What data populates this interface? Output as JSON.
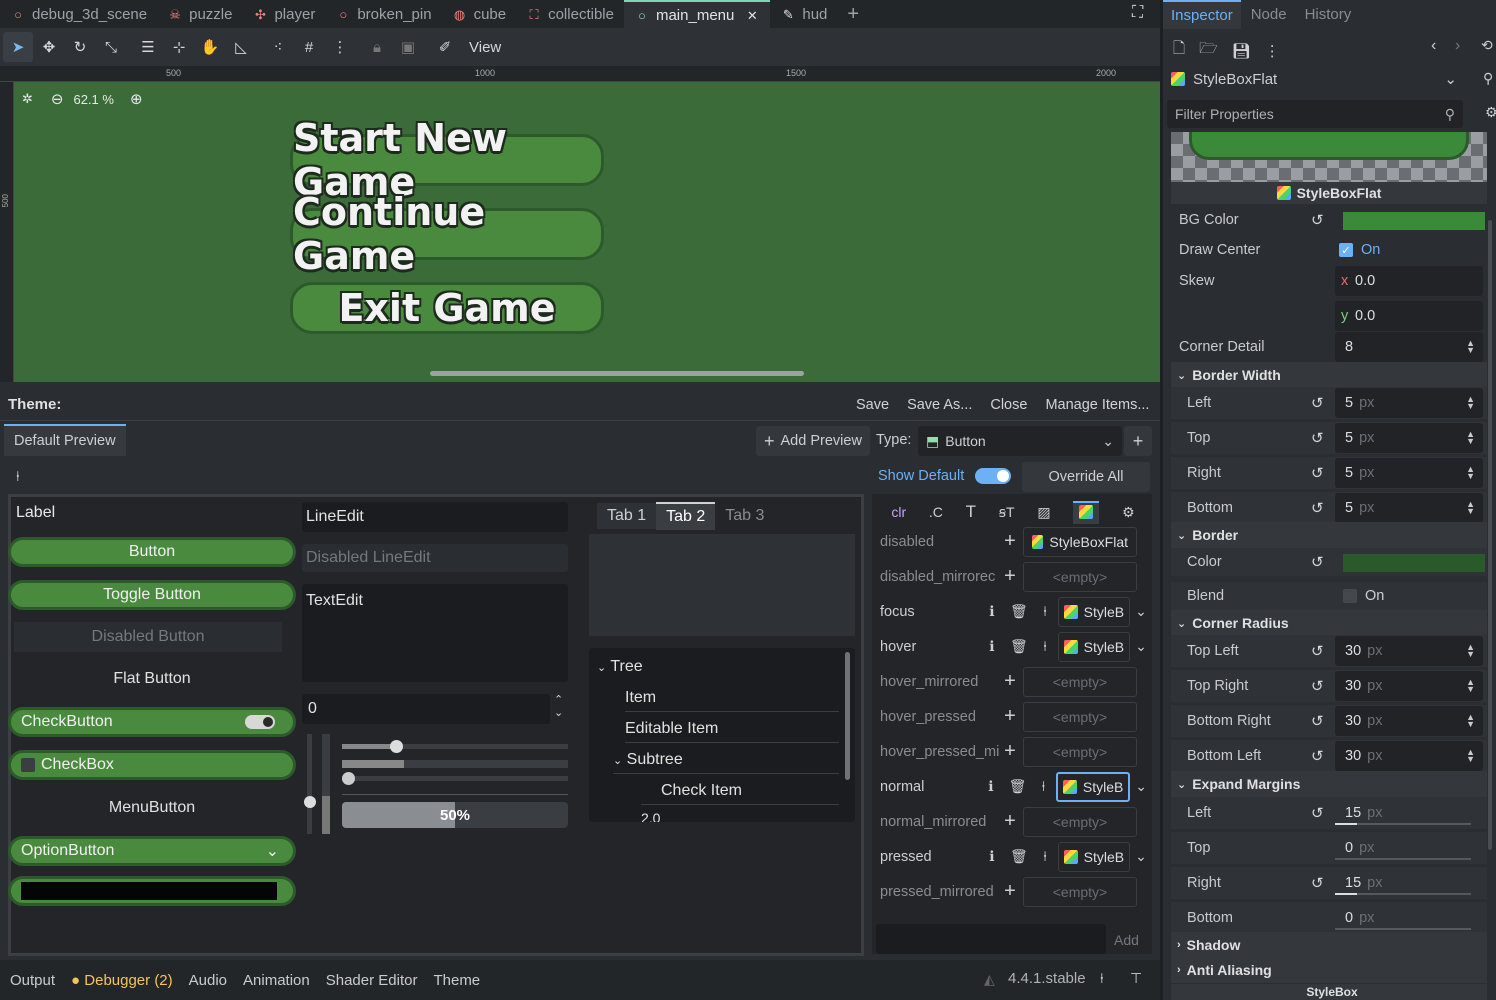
{
  "scene_tabs": [
    {
      "label": "debug_3d_scene",
      "icon": "circle-icon"
    },
    {
      "label": "puzzle",
      "icon": "skull-icon"
    },
    {
      "label": "player",
      "icon": "bone-icon"
    },
    {
      "label": "broken_pin",
      "icon": "circle-icon"
    },
    {
      "label": "cube",
      "icon": "sphere-icon"
    },
    {
      "label": "collectible",
      "icon": "bracket-icon"
    },
    {
      "label": "main_menu",
      "icon": "circle-icon",
      "active": true
    },
    {
      "label": "hud",
      "icon": "pencil-icon"
    }
  ],
  "toolbar": {
    "view_label": "View"
  },
  "ruler": {
    "top": [
      "500",
      "1000",
      "1500",
      "2000"
    ],
    "left": [
      "500"
    ]
  },
  "viewport": {
    "zoom": "62.1 %",
    "buttons": [
      "Start New Game",
      "Continue Game",
      "Exit Game"
    ]
  },
  "theme": {
    "title": "Theme:",
    "save": "Save",
    "save_as": "Save As...",
    "close": "Close",
    "manage": "Manage Items...",
    "preview_tab": "Default Preview",
    "add_preview": "Add Preview",
    "type_label": "Type:",
    "type_value": "Button",
    "show_default": "Show Default",
    "override_all": "Override All",
    "preview": {
      "label": "Label",
      "button": "Button",
      "toggle": "Toggle Button",
      "disabled": "Disabled Button",
      "flat": "Flat Button",
      "checkbutton": "CheckButton",
      "checkbox": "CheckBox",
      "menubutton": "MenuButton",
      "optionbutton": "OptionButton",
      "lineedit": "LineEdit",
      "disabled_lineedit": "Disabled LineEdit",
      "textedit": "TextEdit",
      "spin_value": "0",
      "progress": "50%",
      "tabs": [
        "Tab 1",
        "Tab 2",
        "Tab 3"
      ],
      "tree": [
        "Tree",
        "Item",
        "Editable Item",
        "Subtree",
        "Check Item",
        "2.0"
      ]
    },
    "styles": [
      {
        "name": "disabled",
        "value": "StyleBoxFlat"
      },
      {
        "name": "disabled_mirrorec",
        "value": "<empty>"
      },
      {
        "name": "focus",
        "value": "StyleB"
      },
      {
        "name": "hover",
        "value": "StyleB"
      },
      {
        "name": "hover_mirrored",
        "value": "<empty>"
      },
      {
        "name": "hover_pressed",
        "value": "<empty>"
      },
      {
        "name": "hover_pressed_mi",
        "value": "<empty>"
      },
      {
        "name": "normal",
        "value": "StyleB"
      },
      {
        "name": "normal_mirrored",
        "value": "<empty>"
      },
      {
        "name": "pressed",
        "value": "StyleB"
      },
      {
        "name": "pressed_mirrored",
        "value": "<empty>"
      }
    ],
    "add_label": "Add"
  },
  "bottom": {
    "tabs": [
      "Output",
      "Debugger (2)",
      "Audio",
      "Animation",
      "Shader Editor",
      "Theme"
    ],
    "version": "4.4.1.stable"
  },
  "inspector": {
    "tabs": [
      "Inspector",
      "Node",
      "History"
    ],
    "resource": "StyleBoxFlat",
    "filter_placeholder": "Filter Properties",
    "preview_title": "StyleBoxFlat",
    "bg_color_label": "BG Color",
    "bg_color": "#3b8a3a",
    "draw_center_label": "Draw Center",
    "draw_center_value": "On",
    "skew_label": "Skew",
    "skew_x": "0.0",
    "skew_y": "0.0",
    "x_label": "x",
    "y_label": "y",
    "corner_detail_label": "Corner Detail",
    "corner_detail": "8",
    "border_width": {
      "title": "Border Width",
      "rows": [
        [
          "Left",
          "5"
        ],
        [
          "Top",
          "5"
        ],
        [
          "Right",
          "5"
        ],
        [
          "Bottom",
          "5"
        ]
      ]
    },
    "border": {
      "title": "Border",
      "color_label": "Color",
      "color": "#2a5a2c",
      "blend_label": "Blend",
      "blend_value": "On"
    },
    "corner_radius": {
      "title": "Corner Radius",
      "rows": [
        [
          "Top Left",
          "30"
        ],
        [
          "Top Right",
          "30"
        ],
        [
          "Bottom Right",
          "30"
        ],
        [
          "Bottom Left",
          "30"
        ]
      ]
    },
    "expand_margins": {
      "title": "Expand Margins",
      "rows": [
        [
          "Left",
          "15"
        ],
        [
          "Top",
          "0"
        ],
        [
          "Right",
          "15"
        ],
        [
          "Bottom",
          "0"
        ]
      ]
    },
    "shadow": "Shadow",
    "anti_aliasing": "Anti Aliasing",
    "stylebox": "StyleBox",
    "unit": "px"
  }
}
